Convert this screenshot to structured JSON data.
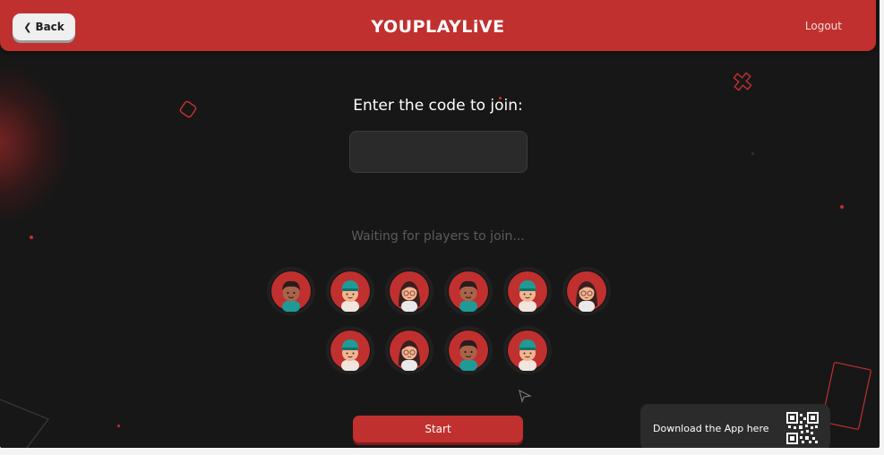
{
  "header": {
    "back_label": "Back",
    "logo": "YOUPLAYLiVE",
    "logout_label": "Logout"
  },
  "join": {
    "title": "Enter the code to join:",
    "code_value": "",
    "waiting_text": "Waiting for players to join..."
  },
  "players": [
    {
      "style": "curly-boy",
      "cap": ""
    },
    {
      "style": "cap-boy",
      "cap": "#1f9a96"
    },
    {
      "style": "girl-glasses",
      "cap": ""
    },
    {
      "style": "curly-boy",
      "cap": ""
    },
    {
      "style": "cap-boy",
      "cap": "#1f9a96"
    },
    {
      "style": "girl-glasses",
      "cap": ""
    },
    {
      "style": "cap-boy",
      "cap": "#1f9a96"
    },
    {
      "style": "girl-glasses",
      "cap": ""
    },
    {
      "style": "curly-boy",
      "cap": ""
    },
    {
      "style": "cap-boy",
      "cap": "#1f9a96"
    }
  ],
  "actions": {
    "start_label": "Start"
  },
  "download": {
    "label": "Download the App here"
  },
  "colors": {
    "accent": "#c0302f",
    "background": "#171717",
    "panel": "#2b2b2b",
    "teal": "#1f9a96"
  }
}
